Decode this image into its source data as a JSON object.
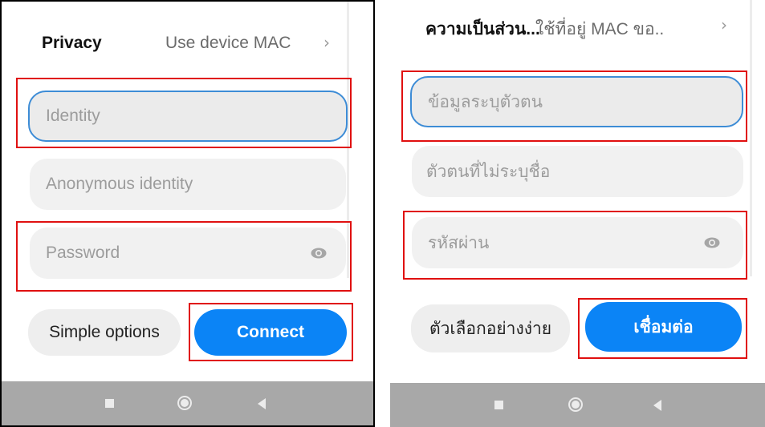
{
  "english": {
    "privacy": {
      "label": "Privacy",
      "value": "Use device MAC"
    },
    "identity_placeholder": "Identity",
    "anonymous_placeholder": "Anonymous identity",
    "password_placeholder": "Password",
    "simple_options": "Simple options",
    "connect": "Connect"
  },
  "thai": {
    "privacy": {
      "label": "ความเป็นส่วน...",
      "value": "ใช้ที่อยู่ MAC ขอ.."
    },
    "identity_placeholder": "ข้อมูลระบุตัวตน",
    "anonymous_placeholder": "ตัวตนที่ไม่ระบุชื่อ",
    "password_placeholder": "รหัสผ่าน",
    "simple_options": "ตัวเลือกอย่างง่าย",
    "connect": "เชื่อมต่อ"
  },
  "icons": {
    "chevron": "chevron-right-icon",
    "password_toggle": "eye-icon",
    "nav_recents": "square-icon",
    "nav_home": "circle-icon",
    "nav_back": "triangle-back-icon"
  },
  "colors": {
    "accent": "#0b84f6",
    "focus_border": "#3d8cd6",
    "highlight": "#e01010",
    "navbar": "#a8a8a8"
  }
}
